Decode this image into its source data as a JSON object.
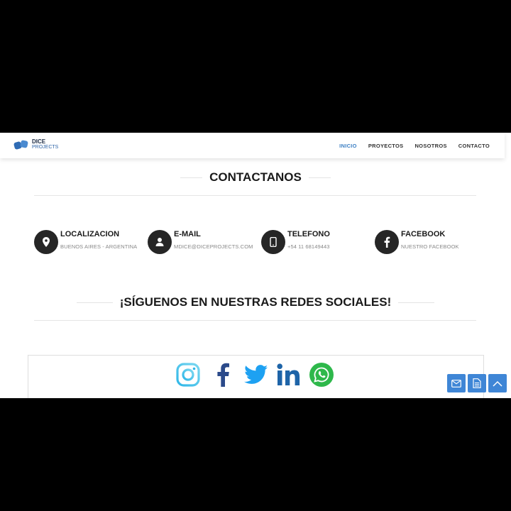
{
  "brand": {
    "line1": "DICE",
    "line2": "PROJECTS"
  },
  "nav": [
    {
      "label": "INICIO",
      "active": true
    },
    {
      "label": "PROYECTOS",
      "active": false
    },
    {
      "label": "NOSOTROS",
      "active": false
    },
    {
      "label": "CONTACTO",
      "active": false
    }
  ],
  "contact_title": "CONTACTANOS",
  "contacts": [
    {
      "icon": "location-pin-icon",
      "title": "LOCALIZACION",
      "value": "BUENOS AIRES - ARGENTINA"
    },
    {
      "icon": "user-icon",
      "title": "E-MAIL",
      "value": "MDICE@DICEPROJECTS.COM"
    },
    {
      "icon": "phone-icon",
      "title": "TELEFONO",
      "value": "+54 11 68149443"
    },
    {
      "icon": "facebook-icon",
      "title": "FACEBOOK",
      "value": "NUESTRO FACEBOOK"
    }
  ],
  "social_title": "¡SÍGUENOS EN NUESTRAS REDES SOCIALES!",
  "social_icons": [
    "instagram-icon",
    "facebook-icon",
    "twitter-icon",
    "linkedin-icon",
    "whatsapp-icon"
  ],
  "floating_buttons": [
    "mail-icon",
    "document-icon",
    "chevron-up-icon"
  ],
  "colors": {
    "accent": "#3b7fc4",
    "button": "#3f86d6",
    "dark_circle": "#262626"
  }
}
